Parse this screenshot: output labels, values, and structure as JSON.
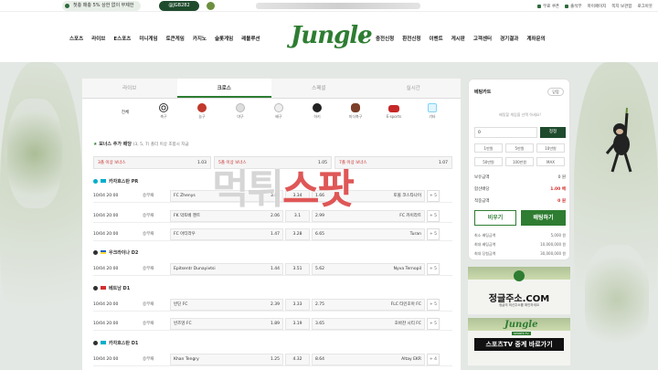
{
  "topbar": {
    "promo_text": "첫충 매충 5% 상한 없이 무제한",
    "promo_badge": "@JGB282",
    "links": [
      "무료 쿠폰",
      "출석부",
      "마이페이지",
      "쪽지 보관함",
      "로그아웃"
    ]
  },
  "nav": {
    "left": [
      "스포츠",
      "라이브",
      "E스포츠",
      "미니게임",
      "토큰게임",
      "카지노",
      "슬롯게임",
      "레볼루션"
    ],
    "right": [
      "충전신청",
      "환전신청",
      "이벤트",
      "게시판",
      "고객센터",
      "경기결과",
      "계좌문의"
    ],
    "logo": "Jungle"
  },
  "tabs": [
    {
      "label": "라이브",
      "active": false
    },
    {
      "label": "크로스",
      "active": true
    },
    {
      "label": "스페셜",
      "active": false
    },
    {
      "label": "실시간",
      "active": false
    }
  ],
  "sports": [
    {
      "label": "전체",
      "icon": "all-icon",
      "color": ""
    },
    {
      "label": "축구",
      "icon": "soccer-icon",
      "color": "#333333"
    },
    {
      "label": "농구",
      "icon": "basketball-icon",
      "color": "#c0392b"
    },
    {
      "label": "야구",
      "icon": "baseball-icon",
      "color": "#cccccc"
    },
    {
      "label": "배구",
      "icon": "volleyball-icon",
      "color": "#dddddd"
    },
    {
      "label": "하키",
      "icon": "hockey-icon",
      "color": "#222222"
    },
    {
      "label": "미식축구",
      "icon": "football-icon",
      "color": "#7b3f2a"
    },
    {
      "label": "E-sports",
      "icon": "esports-icon",
      "color": "#c62828"
    },
    {
      "label": "기타",
      "icon": "etc-icon",
      "color": "#b3e5fc"
    }
  ],
  "bonus": {
    "title": "보너스 추가 배당",
    "subtitle": "(3, 5, 7) 폴더 이상 조합시 지급",
    "cells": [
      {
        "label": "3폴 이상 보너스",
        "value": "1.03"
      },
      {
        "label": "5폴 이상 보너스",
        "value": "1.05"
      },
      {
        "label": "7폴 이상 보너스",
        "value": "1.07"
      }
    ]
  },
  "leagues": [
    {
      "name": "카자흐스탄 PR",
      "flag": "kz",
      "matches": [
        {
          "date": "10/04 20:00",
          "market": "승무패",
          "home": "FC Zhenys",
          "home_odd": "3.82",
          "draw": "3.34",
          "away_odd": "1.66",
          "away": "토볼 코스타나이",
          "more": "+ 5"
        },
        {
          "date": "10/04 20:00",
          "market": "승무패",
          "home": "FK 악토베 젠트",
          "home_odd": "2.06",
          "draw": "3.1",
          "away_odd": "2.99",
          "away": "FC 카이라트",
          "more": "+ 5"
        },
        {
          "date": "10/04 20:00",
          "market": "승무패",
          "home": "FC 아티라우",
          "home_odd": "1.47",
          "draw": "3.28",
          "away_odd": "6.65",
          "away": "Turan",
          "more": "+ 5"
        }
      ]
    },
    {
      "name": "우크라이나 D2",
      "flag": "ua",
      "matches": [
        {
          "date": "10/04 20:00",
          "market": "승무패",
          "home": "Epitsentr Dunayivtsi",
          "home_odd": "1.44",
          "draw": "3.51",
          "away_odd": "5.62",
          "away": "Nyva Ternopil",
          "more": "+ 5"
        }
      ]
    },
    {
      "name": "베트남 D1",
      "flag": "vn",
      "matches": [
        {
          "date": "10/04 20:00",
          "market": "승무패",
          "home": "빈딘 FC",
          "home_odd": "2.39",
          "draw": "3.33",
          "away_odd": "2.75",
          "away": "FLC 타인호아 FC",
          "more": "+ 5"
        },
        {
          "date": "10/04 20:00",
          "market": "승무패",
          "home": "빈즈엉 FC",
          "home_odd": "1.89",
          "draw": "3.19",
          "away_odd": "3.65",
          "away": "호바찬 시티 FC",
          "more": "+ 5"
        }
      ]
    },
    {
      "name": "카자흐스탄 D1",
      "flag": "kz",
      "matches": [
        {
          "date": "10/04 20:00",
          "market": "승무패",
          "home": "Khan Tengry",
          "home_odd": "1.25",
          "draw": "4.32",
          "away_odd": "8.64",
          "away": "Altay EKR",
          "more": "+ 4"
        }
      ]
    }
  ],
  "watermark": {
    "part1": "먹튀",
    "part2": "스팟"
  },
  "slip": {
    "title": "베팅카트",
    "close": "닫힘",
    "hint": "배팅할 게임을 선택 하세요!",
    "amount": "0",
    "reset": "정정",
    "quick": [
      "1만원",
      "5만원",
      "10만원",
      "50만원",
      "100만원",
      "MAX"
    ],
    "rows": [
      {
        "label": "보유금액",
        "value": "0 원",
        "red": false
      },
      {
        "label": "합산배당",
        "value": "1.00 배",
        "red": true
      },
      {
        "label": "적중금액",
        "value": "0 원",
        "red": true
      }
    ],
    "cancel": "비우기",
    "bet": "배팅하기",
    "limits": [
      {
        "label": "최소 배팅금액",
        "value": "5,000 원"
      },
      {
        "label": "최대 배팅금액",
        "value": "10,000,000 원"
      },
      {
        "label": "최대 당첨금액",
        "value": "30,000,000 원"
      }
    ]
  },
  "banners": [
    {
      "title": "정글주소.COM",
      "sub": "정글의 최신주소를 확인하세요"
    },
    {
      "title": "스포츠TV 중계 바로가기",
      "sub": "SPORTS TV"
    }
  ]
}
